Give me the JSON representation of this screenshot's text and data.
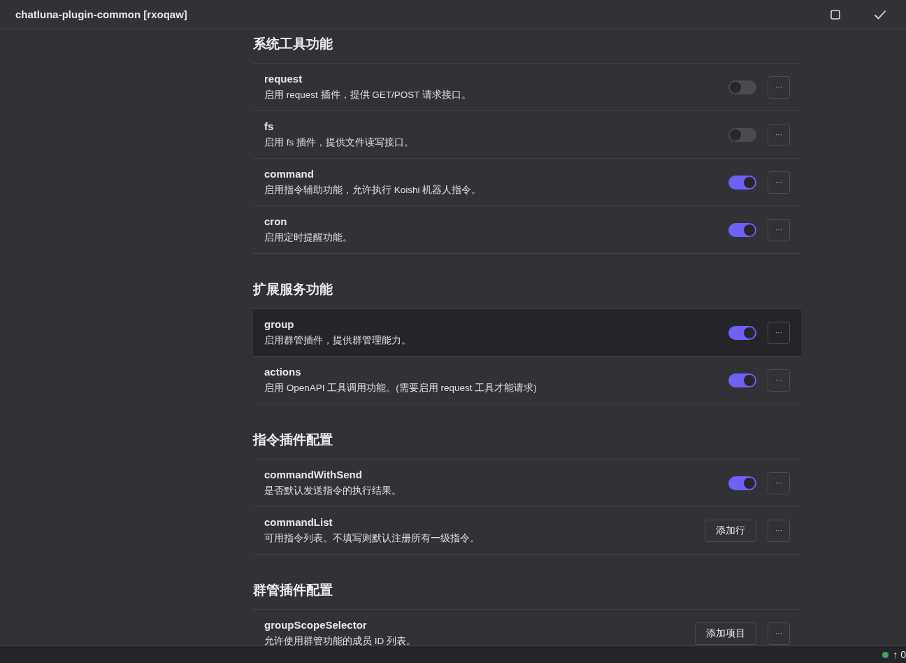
{
  "header": {
    "title": "chatluna-plugin-common [rxoqaw]"
  },
  "sections": [
    {
      "title": "系统工具功能",
      "items": [
        {
          "name": "request",
          "description": "启用 request 插件，提供 GET/POST 请求接口。",
          "kind": "toggle",
          "on": false,
          "selected": false,
          "more": "···"
        },
        {
          "name": "fs",
          "description": "启用 fs 插件，提供文件读写接口。",
          "kind": "toggle",
          "on": false,
          "selected": false,
          "more": "···"
        },
        {
          "name": "command",
          "description": "启用指令辅助功能，允许执行 Koishi 机器人指令。",
          "kind": "toggle",
          "on": true,
          "selected": false,
          "more": "···"
        },
        {
          "name": "cron",
          "description": "启用定时提醒功能。",
          "kind": "toggle",
          "on": true,
          "selected": false,
          "more": "···"
        }
      ]
    },
    {
      "title": "扩展服务功能",
      "items": [
        {
          "name": "group",
          "description": "启用群管插件，提供群管理能力。",
          "kind": "toggle",
          "on": true,
          "selected": true,
          "more": "···"
        },
        {
          "name": "actions",
          "description": "启用 OpenAPI 工具调用功能。(需要启用 request 工具才能请求)",
          "kind": "toggle",
          "on": true,
          "selected": false,
          "more": "···"
        }
      ]
    },
    {
      "title": "指令插件配置",
      "items": [
        {
          "name": "commandWithSend",
          "description": "是否默认发送指令的执行结果。",
          "kind": "toggle",
          "on": true,
          "selected": false,
          "more": "···"
        },
        {
          "name": "commandList",
          "description": "可用指令列表。不填写则默认注册所有一级指令。",
          "kind": "button",
          "button": "添加行",
          "selected": false,
          "more": "···"
        }
      ]
    },
    {
      "title": "群管插件配置",
      "items": [
        {
          "name": "groupScopeSelector",
          "description": "允许使用群管功能的成员 ID 列表。",
          "kind": "button",
          "button": "添加项目",
          "selected": false,
          "more": "···"
        }
      ]
    }
  ],
  "status_bar": {
    "connected": true,
    "text": "↑ 0"
  }
}
